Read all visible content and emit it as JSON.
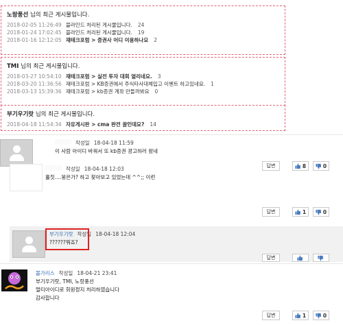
{
  "boxes": [
    {
      "nick": "노랑풍선",
      "suffix": "님의 최근 게시물입니다.",
      "rows": [
        {
          "date": "2018-02-05 11:26:49",
          "text": "블라인드 처리된 게시물입니다.",
          "count": "24",
          "bold": false
        },
        {
          "date": "2018-01-24 17:02:45",
          "text": "블라인드 처리된 게시물입니다.",
          "count": "19",
          "bold": false
        },
        {
          "date": "2018-01-16 12:12:05",
          "text": "재테크포럼 > 증권사 어디 이용하나요",
          "count": "2",
          "bold": true
        }
      ]
    },
    {
      "nick": "TMI",
      "suffix": "님의 최근 게시물입니다.",
      "rows": [
        {
          "date": "2018-03-27 10:54:10",
          "text": "재테크포럼 > 실전 투자 대회 열리네요.",
          "count": "3",
          "bold": true
        },
        {
          "date": "2018-03-20 11:36:56",
          "text": "재테크포럼 > KB증권에서 주식타사대체입고 이벤트 하고있네요.",
          "count": "1",
          "bold": false
        },
        {
          "date": "2018-03-13 15:39:36",
          "text": "재테크포럼 > kb증권 계좌 만들까봐요",
          "count": "0",
          "bold": false
        }
      ]
    },
    {
      "nick": "부기우기랏",
      "suffix": "님의 최근 게시물입니다.",
      "rows": [
        {
          "date": "2018-04-18 11:54:34",
          "text": "자유게시판 > cma 완전 꿀인데요?",
          "count": "14",
          "bold": true
        }
      ]
    }
  ],
  "comments": [
    {
      "nick": "",
      "label": "작성일",
      "date": "18-04-18 11:59",
      "text": [
        "이 사람 아이디 바꿔서 또 kb증권 광고하러 왔네"
      ],
      "reply": "답변",
      "up": "8",
      "down": "0"
    },
    {
      "nick": "",
      "label": "작성일",
      "date": "18-04-18 12:03",
      "text": [
        "홀짓....뭉은가? 하고 찾아보고 있었는데 ^^;; 이런"
      ],
      "reply": "답변",
      "up": "1",
      "down": "0"
    },
    {
      "nick": "부기우기랏",
      "label": "작성일",
      "date": "18-04-18 12:04",
      "text": [
        "??????뭐죠?"
      ],
      "reply": "답변",
      "up": "",
      "down": ""
    },
    {
      "nick": "볼가리스",
      "label": "작성일",
      "date": "18-04-21 23:41",
      "text": [
        "부기우기랏, TMI, 노랑풍선",
        "멀티아이디로 회원정지 처리하였습니다",
        "감사합니다"
      ],
      "reply": "답변",
      "up": "1",
      "down": "0"
    }
  ],
  "colors": {
    "dashed_border": "#e0607a",
    "highlight": "#e02020",
    "nick": "#3a6fb7"
  },
  "icons": {
    "up": "thumbs-up-icon",
    "down": "thumbs-down-icon",
    "avatar": "default-user-icon",
    "badge": "user-badge-icon"
  }
}
